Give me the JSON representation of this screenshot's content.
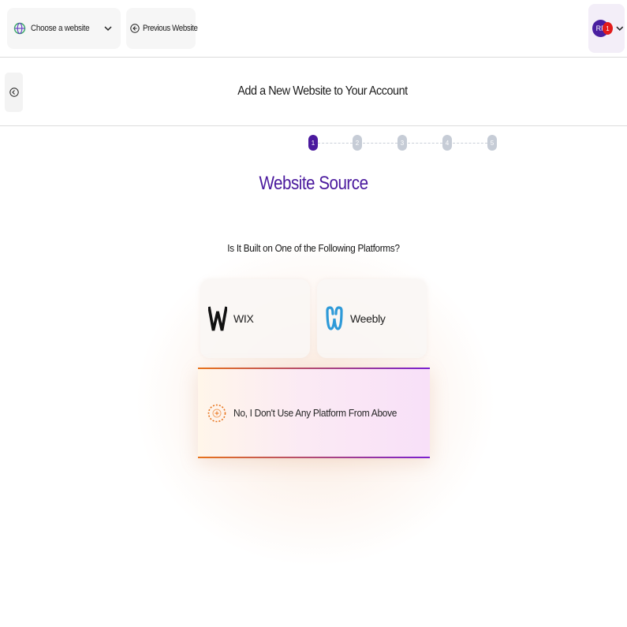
{
  "topbar": {
    "site_select": {
      "label": "Choose a website",
      "icon": "globe-icon"
    },
    "previous_button": {
      "label": "Previous Website",
      "icon": "arrow-left-circle-icon"
    },
    "account": {
      "avatar_initials": "RF",
      "notification_count": "1"
    }
  },
  "header": {
    "back_icon": "arrow-left-circle-icon",
    "title": "Add a New Website to Your Account"
  },
  "stepper": {
    "steps": [
      "1",
      "2",
      "3",
      "4",
      "5"
    ],
    "active_step": 1
  },
  "section": {
    "title": "Website Source",
    "question": "Is It Built on One of the Following Platforms?"
  },
  "platforms": [
    {
      "label": "WIX",
      "icon": "wix-logo"
    },
    {
      "label": "Weebly",
      "icon": "weebly-logo"
    }
  ],
  "none_option": {
    "label": "No, I Don't Use Any Platform From Above",
    "icon": "plus-circle-icon"
  },
  "colors": {
    "accent": "#4b1a9e",
    "step_inactive": "#c6ccd6",
    "gradient_start": "#e8731a",
    "gradient_end": "#7a1fd1",
    "weebly_blue": "#2e9ad8",
    "badge_red": "#e21b1b"
  }
}
